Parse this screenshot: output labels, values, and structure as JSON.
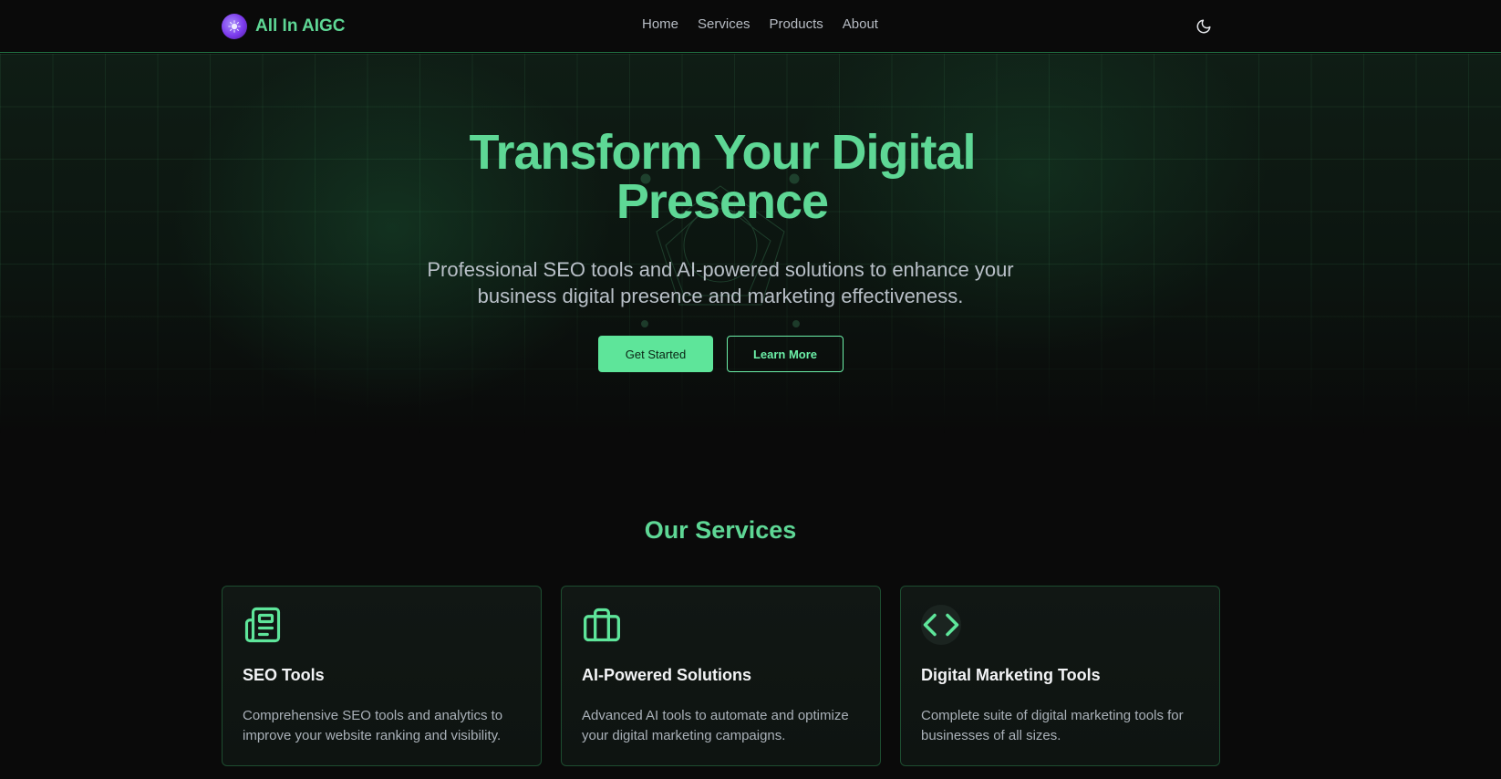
{
  "header": {
    "brand": "All In AIGC",
    "nav": [
      "Home",
      "Services",
      "Products",
      "About"
    ]
  },
  "hero": {
    "title_line1": "Transform Your Digital",
    "title_line2": "Presence",
    "subtitle_line1": "Professional SEO tools and AI-powered solutions to enhance your",
    "subtitle_line2": "business digital presence and marketing effectiveness.",
    "primary_button": "Get Started",
    "secondary_button": "Learn More"
  },
  "services": {
    "title": "Our Services",
    "cards": [
      {
        "title": "SEO Tools",
        "description": "Comprehensive SEO tools and analytics to improve your website ranking and visibility.",
        "icon": "newspaper-icon"
      },
      {
        "title": "AI-Powered Solutions",
        "description": "Advanced AI tools to automate and optimize your digital marketing campaigns.",
        "icon": "briefcase-icon"
      },
      {
        "title": "Digital Marketing Tools",
        "description": "Complete suite of digital marketing tools for businesses of all sizes.",
        "icon": "code-icon"
      }
    ]
  },
  "colors": {
    "accent": "#5ed795",
    "button": "#5ee59a",
    "background": "#0a0a0a"
  }
}
